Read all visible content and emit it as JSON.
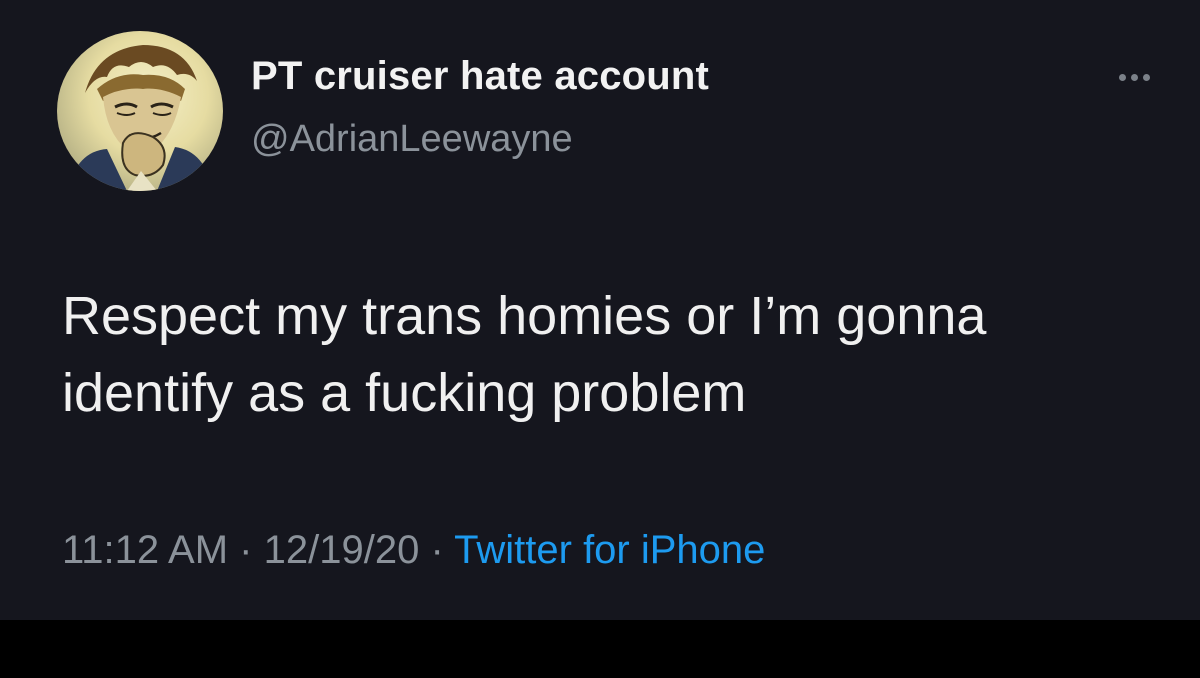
{
  "tweet": {
    "display_name": "PT cruiser hate account",
    "handle": "@AdrianLeewayne",
    "more_icon": "more-options-icon",
    "text_lines": [
      "Respect my trans homies or I’m gonna",
      "identify as a fucking problem"
    ],
    "time": "11:12 AM",
    "date": "12/19/20",
    "separator": "·",
    "source": "Twitter for iPhone"
  },
  "colors": {
    "background": "#15161e",
    "text": "#f0f0f0",
    "secondary_text": "#8b929a",
    "link": "#1d9bf0"
  }
}
